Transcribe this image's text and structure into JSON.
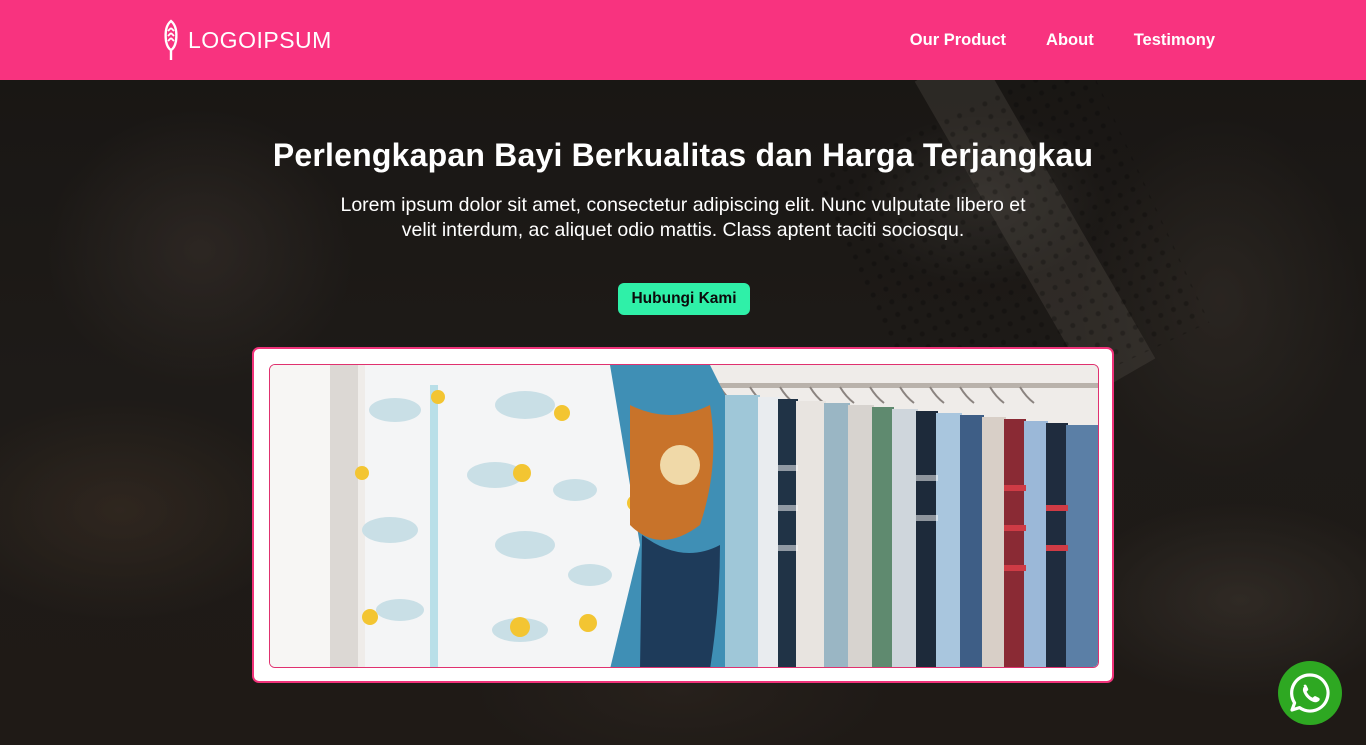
{
  "navbar": {
    "logo_text": "LOGOIPSUM",
    "logo_icon": "feather-icon",
    "links": [
      "Our Product",
      "About",
      "Testimony"
    ]
  },
  "hero": {
    "title": "Perlengkapan Bayi Berkualitas dan Harga Terjangkau",
    "description": "Lorem ipsum dolor sit amet, consectetur adipiscing elit. Nunc vulputate libero et velit interdum, ac aliquet odio mattis. Class aptent taciti sociosqu.",
    "cta_label": "Hubungi Kami"
  },
  "floating": {
    "whatsapp_icon": "whatsapp-icon"
  },
  "colors": {
    "brand_pink": "#f8337f",
    "cta_green": "#2ff0a8",
    "whatsapp_green": "#2ea822",
    "card_border": "#f0337a"
  }
}
